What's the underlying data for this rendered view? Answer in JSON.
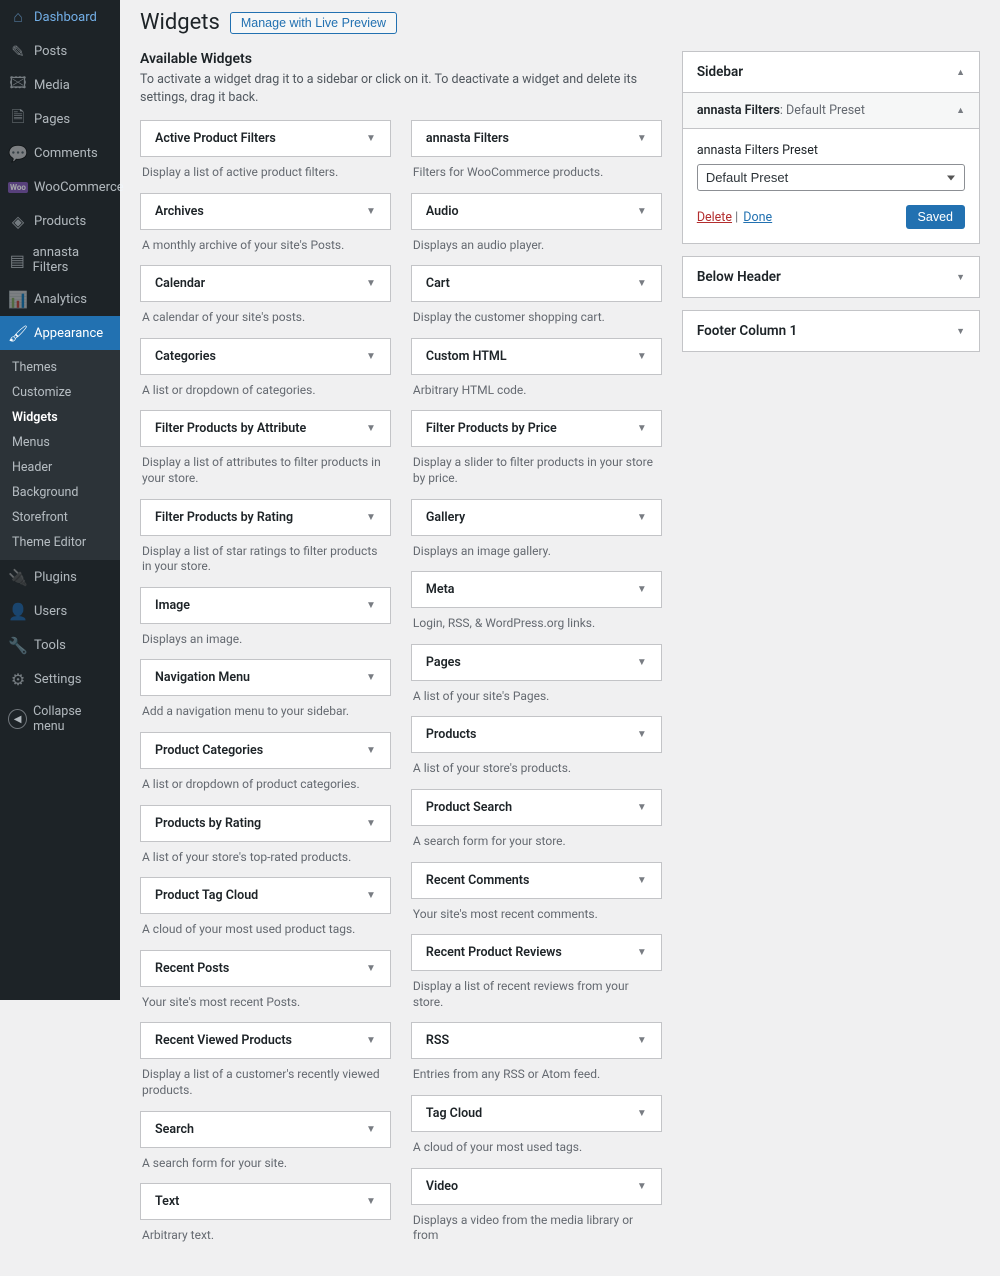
{
  "nav": {
    "items": [
      {
        "label": "Dashboard",
        "icon": "⌂"
      },
      {
        "label": "Posts",
        "icon": "✎"
      },
      {
        "label": "Media",
        "icon": "🖾"
      },
      {
        "label": "Pages",
        "icon": "🗎"
      },
      {
        "label": "Comments",
        "icon": "💬"
      },
      {
        "label": "WooCommerce",
        "icon": "woo"
      },
      {
        "label": "Products",
        "icon": "◈"
      },
      {
        "label": "annasta Filters",
        "icon": "▤"
      },
      {
        "label": "Analytics",
        "icon": "📊"
      },
      {
        "label": "Appearance",
        "icon": "🖌",
        "current": true
      },
      {
        "label": "Plugins",
        "icon": "🔌"
      },
      {
        "label": "Users",
        "icon": "👤"
      },
      {
        "label": "Tools",
        "icon": "🔧"
      },
      {
        "label": "Settings",
        "icon": "⚙"
      }
    ],
    "submenu": [
      "Themes",
      "Customize",
      "Widgets",
      "Menus",
      "Header",
      "Background",
      "Storefront",
      "Theme Editor"
    ],
    "submenu_current": "Widgets",
    "collapse": "Collapse menu"
  },
  "header": {
    "title": "Widgets",
    "preview_btn": "Manage with Live Preview"
  },
  "available": {
    "title": "Available Widgets",
    "desc": "To activate a widget drag it to a sidebar or click on it. To deactivate a widget and delete its settings, drag it back."
  },
  "widgets_left": [
    {
      "name": "Active Product Filters",
      "desc": "Display a list of active product filters."
    },
    {
      "name": "Archives",
      "desc": "A monthly archive of your site's Posts."
    },
    {
      "name": "Calendar",
      "desc": "A calendar of your site's posts."
    },
    {
      "name": "Categories",
      "desc": "A list or dropdown of categories."
    },
    {
      "name": "Filter Products by Attribute",
      "desc": "Display a list of attributes to filter products in your store."
    },
    {
      "name": "Filter Products by Rating",
      "desc": "Display a list of star ratings to filter products in your store."
    },
    {
      "name": "Image",
      "desc": "Displays an image."
    },
    {
      "name": "Navigation Menu",
      "desc": "Add a navigation menu to your sidebar."
    },
    {
      "name": "Product Categories",
      "desc": "A list or dropdown of product categories."
    },
    {
      "name": "Products by Rating",
      "desc": "A list of your store's top-rated products."
    },
    {
      "name": "Product Tag Cloud",
      "desc": "A cloud of your most used product tags."
    },
    {
      "name": "Recent Posts",
      "desc": "Your site's most recent Posts."
    },
    {
      "name": "Recent Viewed Products",
      "desc": "Display a list of a customer's recently viewed products."
    },
    {
      "name": "Search",
      "desc": "A search form for your site."
    },
    {
      "name": "Text",
      "desc": "Arbitrary text."
    }
  ],
  "widgets_right": [
    {
      "name": "annasta Filters",
      "desc": "Filters for WooCommerce products."
    },
    {
      "name": "Audio",
      "desc": "Displays an audio player."
    },
    {
      "name": "Cart",
      "desc": "Display the customer shopping cart."
    },
    {
      "name": "Custom HTML",
      "desc": "Arbitrary HTML code."
    },
    {
      "name": "Filter Products by Price",
      "desc": "Display a slider to filter products in your store by price."
    },
    {
      "name": "Gallery",
      "desc": "Displays an image gallery."
    },
    {
      "name": "Meta",
      "desc": "Login, RSS, & WordPress.org links."
    },
    {
      "name": "Pages",
      "desc": "A list of your site's Pages."
    },
    {
      "name": "Products",
      "desc": "A list of your store's products."
    },
    {
      "name": "Product Search",
      "desc": "A search form for your store."
    },
    {
      "name": "Recent Comments",
      "desc": "Your site's most recent comments."
    },
    {
      "name": "Recent Product Reviews",
      "desc": "Display a list of recent reviews from your store."
    },
    {
      "name": "RSS",
      "desc": "Entries from any RSS or Atom feed."
    },
    {
      "name": "Tag Cloud",
      "desc": "A cloud of your most used tags."
    },
    {
      "name": "Video",
      "desc": "Displays a video from the media library or from"
    }
  ],
  "areas": {
    "sidebar": {
      "title": "Sidebar",
      "widget_name": "annasta Filters",
      "widget_sub": ": Default Preset",
      "preset_label": "annasta Filters Preset",
      "preset_value": "Default Preset",
      "delete": "Delete",
      "done": "Done",
      "saved": "Saved"
    },
    "below_header": "Below Header",
    "footer1": "Footer Column 1"
  }
}
